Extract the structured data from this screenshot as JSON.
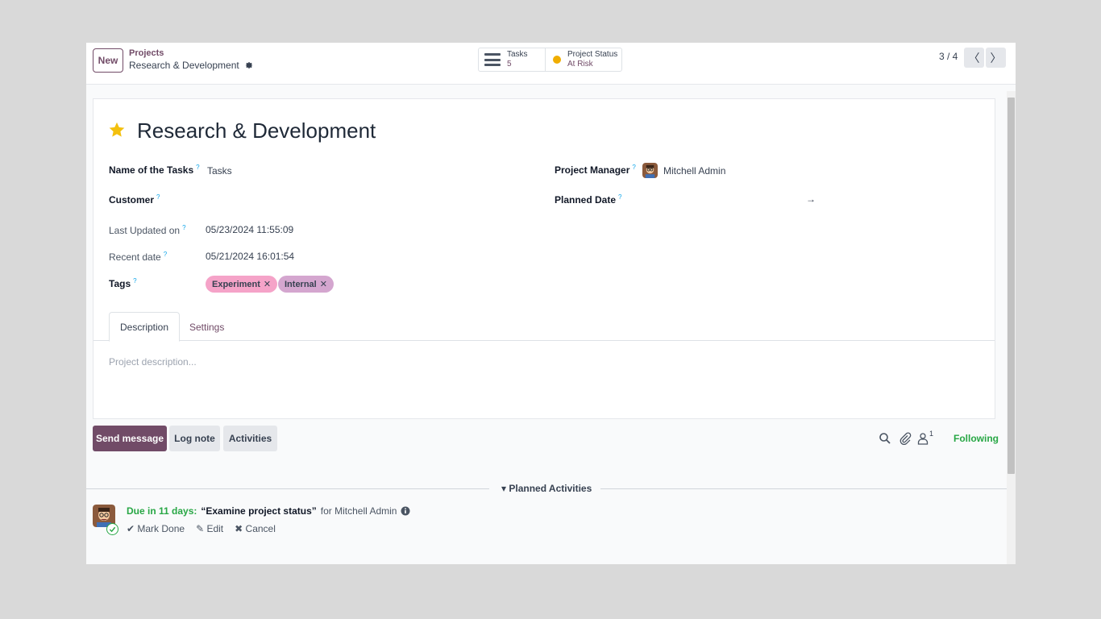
{
  "control_panel": {
    "new_label": "New",
    "breadcrumb_parent": "Projects",
    "breadcrumb_current": "Research & Development",
    "smart_buttons": {
      "tasks_label": "Tasks",
      "tasks_count": "5",
      "status_label": "Project Status",
      "status_value": "At Risk"
    },
    "pager": "3 / 4",
    "prev_symbol": "〈",
    "next_symbol": "〉"
  },
  "form": {
    "title": "Research & Development",
    "fields": {
      "name_of_tasks_label": "Name of the Tasks",
      "name_of_tasks_value": "Tasks",
      "customer_label": "Customer",
      "last_updated_label": "Last Updated on",
      "last_updated_value": "05/23/2024 11:55:09",
      "recent_date_label": "Recent date",
      "recent_date_value": "05/21/2024 16:01:54",
      "tags_label": "Tags",
      "project_manager_label": "Project Manager",
      "project_manager_value": "Mitchell Admin",
      "planned_date_label": "Planned Date",
      "planned_date_arrow": "→",
      "help_mark": "?"
    },
    "tags": [
      {
        "label": "Experiment",
        "color": "#f5a3c8"
      },
      {
        "label": "Internal",
        "color": "#d4a6cf"
      }
    ],
    "tag_remove": "✕",
    "tabs": [
      {
        "label": "Description",
        "active": true
      },
      {
        "label": "Settings",
        "active": false
      }
    ],
    "description_placeholder": "Project description..."
  },
  "chatter": {
    "send_message": "Send message",
    "log_note": "Log note",
    "activities": "Activities",
    "followers_count": "1",
    "following": "Following",
    "planned_activities": "▾ Planned Activities",
    "activity": {
      "due": "Due in 11 days:",
      "summary": "“Examine project status”",
      "for": "for Mitchell Admin",
      "mark_done": "✔ Mark Done",
      "edit": "✎ Edit",
      "cancel": "✖ Cancel"
    }
  },
  "colors": {
    "brand": "#714b67",
    "following": "#28a745",
    "status_dot": "#f0ad00"
  },
  "icons": [
    "gear-icon",
    "tasks-icon",
    "status-dot-icon",
    "star-icon",
    "avatar-icon",
    "search-icon",
    "paperclip-icon",
    "followers-icon",
    "info-icon"
  ]
}
